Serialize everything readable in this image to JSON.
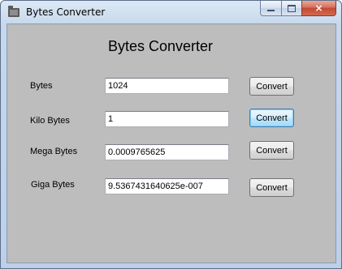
{
  "window": {
    "title": "Bytes Converter",
    "icon": "folder-icon",
    "controls": {
      "minimize": "minimize-icon",
      "maximize": "maximize-icon",
      "close_glyph": "×"
    }
  },
  "form": {
    "heading": "Bytes Converter",
    "rows": [
      {
        "label": "Bytes",
        "value": "1024",
        "button": "Convert"
      },
      {
        "label": "Kilo Bytes",
        "value": "1",
        "button": "Convert"
      },
      {
        "label": "Mega Bytes",
        "value": "0.0009765625",
        "button": "Convert"
      },
      {
        "label": "Giga Bytes",
        "value": "9.5367431640625e-007",
        "button": "Convert"
      }
    ]
  },
  "colors": {
    "client_background": "#bdbdbd",
    "focus_border": "#3c7fb1"
  }
}
